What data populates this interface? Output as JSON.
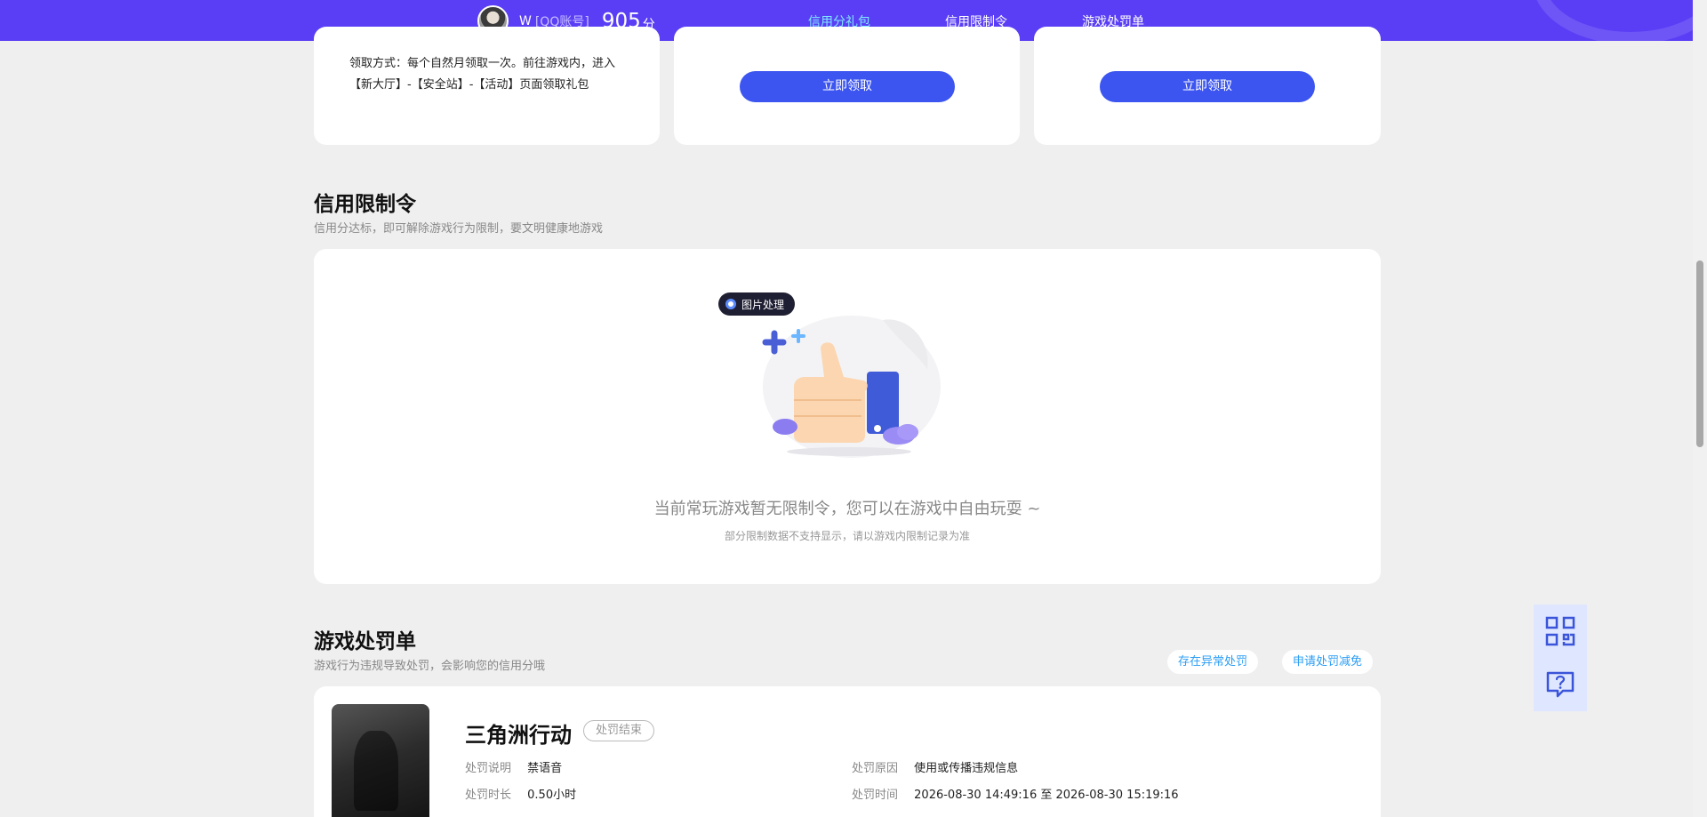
{
  "header": {
    "user_name": "W",
    "account_label": "[QQ账号]",
    "score": "905",
    "score_unit": "分",
    "nav": [
      {
        "label": "信用分礼包",
        "active": true
      },
      {
        "label": "信用限制令",
        "active": false
      },
      {
        "label": "游戏处罚单",
        "active": false
      }
    ]
  },
  "gifts": {
    "card1_text": "领取方式：每个自然月领取一次。前往游戏内，进入【新大厅】-【安全站】-【活动】页面领取礼包",
    "claim_label": "立即领取"
  },
  "limit_section": {
    "title": "信用限制令",
    "subtitle": "信用分达标，即可解除游戏行为限制，要文明健康地游戏",
    "image_tag": "图片处理",
    "empty_main": "当前常玩游戏暂无限制令，您可以在游戏中自由玩耍 ~",
    "empty_sub": "部分限制数据不支持显示，请以游戏内限制记录为准"
  },
  "penalty_section": {
    "title": "游戏处罚单",
    "subtitle": "游戏行为违规导致处罚，会影响您的信用分哦",
    "btn_abnormal": "存在异常处罚",
    "btn_reduce": "申请处罚减免",
    "item": {
      "game": "三角洲行动",
      "status": "处罚结束",
      "desc_label": "处罚说明",
      "desc_value": "禁语音",
      "reason_label": "处罚原因",
      "reason_value": "使用或传播违规信息",
      "duration_label": "处罚时长",
      "duration_value": "0.50小时",
      "time_label": "处罚时间",
      "time_value": "2026-08-30 14:49:16 至 2026-08-30 15:19:16"
    }
  },
  "colors": {
    "header_bg": "#5a3ef5",
    "nav_active": "#7fe9ff",
    "primary_button": "#3c55f0",
    "link_blue": "#2a9df4",
    "page_bg": "#efefef"
  },
  "icons": [
    "qr-code-icon",
    "help-chat-icon",
    "thumbs-up-illustration"
  ]
}
